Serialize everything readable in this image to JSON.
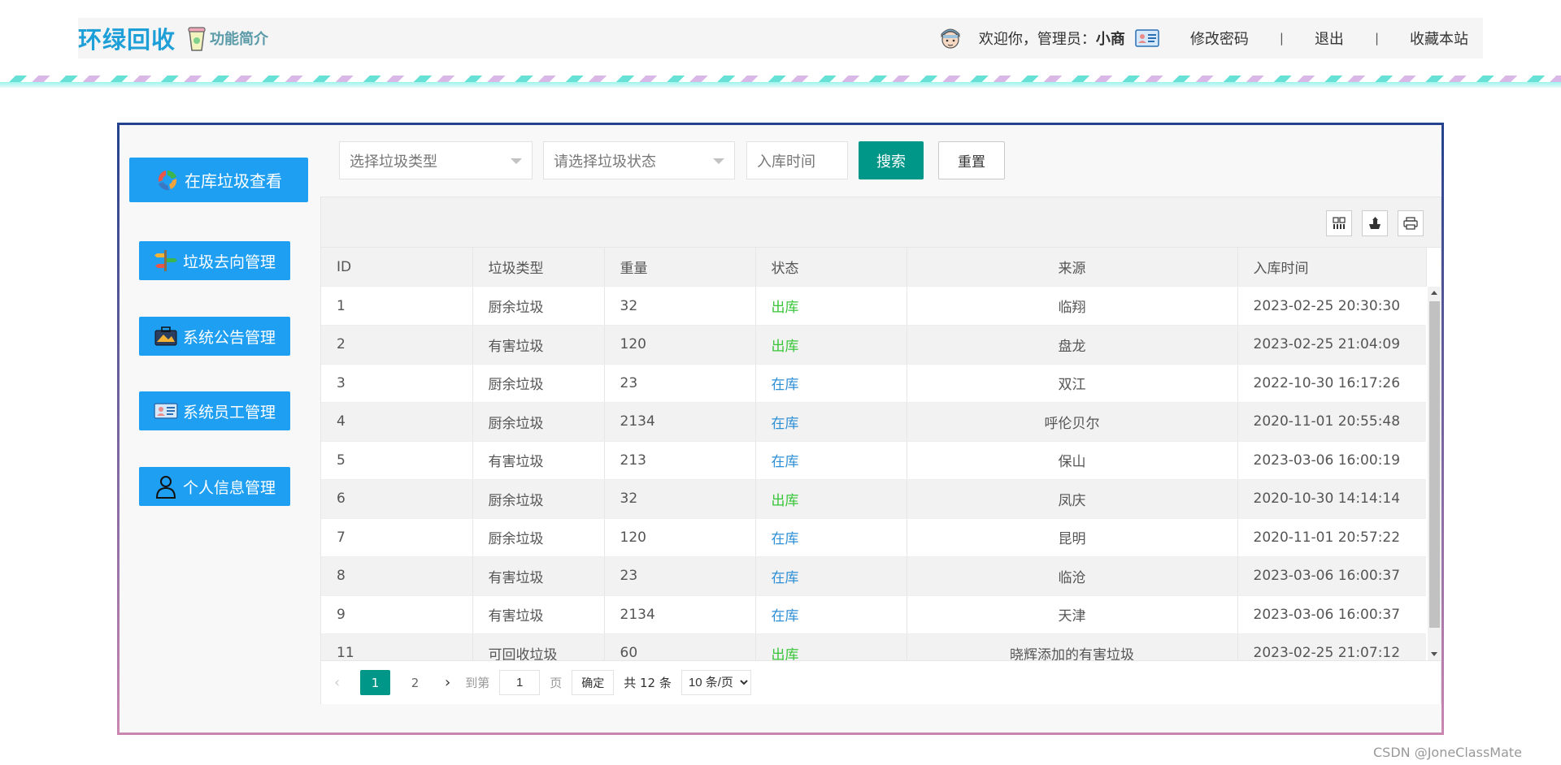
{
  "header": {
    "brand": "环绿回收",
    "intro_link": "功能简介",
    "welcome_prefix": "欢迎你，管理员：",
    "user_name": "小商",
    "change_password": "修改密码",
    "logout": "退出",
    "bookmark": "收藏本站",
    "separator": "|"
  },
  "sidebar": {
    "items": [
      {
        "label": "在库垃圾查看",
        "icon": "recycle-icon"
      },
      {
        "label": "垃圾去向管理",
        "icon": "signpost-icon"
      },
      {
        "label": "系统公告管理",
        "icon": "briefcase-icon"
      },
      {
        "label": "系统员工管理",
        "icon": "id-card-icon"
      },
      {
        "label": "个人信息管理",
        "icon": "person-icon"
      }
    ]
  },
  "filters": {
    "type_placeholder": "选择垃圾类型",
    "status_placeholder": "请选择垃圾状态",
    "date_placeholder": "入库时间",
    "search_label": "搜索",
    "reset_label": "重置"
  },
  "toolbar": {
    "icons": [
      "columns-icon",
      "export-icon",
      "print-icon"
    ]
  },
  "table": {
    "headers": [
      "ID",
      "垃圾类型",
      "重量",
      "状态",
      "来源",
      "入库时间"
    ],
    "rows": [
      {
        "id": "1",
        "type": "厨余垃圾",
        "weight": "32",
        "status": "出库",
        "source": "临翔",
        "time": "2023-02-25 20:30:30"
      },
      {
        "id": "2",
        "type": "有害垃圾",
        "weight": "120",
        "status": "出库",
        "source": "盘龙",
        "time": "2023-02-25 21:04:09"
      },
      {
        "id": "3",
        "type": "厨余垃圾",
        "weight": "23",
        "status": "在库",
        "source": "双江",
        "time": "2022-10-30 16:17:26"
      },
      {
        "id": "4",
        "type": "厨余垃圾",
        "weight": "2134",
        "status": "在库",
        "source": "呼伦贝尔",
        "time": "2020-11-01 20:55:48"
      },
      {
        "id": "5",
        "type": "有害垃圾",
        "weight": "213",
        "status": "在库",
        "source": "保山",
        "time": "2023-03-06 16:00:19"
      },
      {
        "id": "6",
        "type": "厨余垃圾",
        "weight": "32",
        "status": "出库",
        "source": "凤庆",
        "time": "2020-10-30 14:14:14"
      },
      {
        "id": "7",
        "type": "厨余垃圾",
        "weight": "120",
        "status": "在库",
        "source": "昆明",
        "time": "2020-11-01 20:57:22"
      },
      {
        "id": "8",
        "type": "有害垃圾",
        "weight": "23",
        "status": "在库",
        "source": "临沧",
        "time": "2023-03-06 16:00:37"
      },
      {
        "id": "9",
        "type": "有害垃圾",
        "weight": "2134",
        "status": "在库",
        "source": "天津",
        "time": "2023-03-06 16:00:37"
      },
      {
        "id": "11",
        "type": "可回收垃圾",
        "weight": "60",
        "status": "出库",
        "source": "晓辉添加的有害垃圾",
        "time": "2023-02-25 21:07:12"
      }
    ],
    "status_colors": {
      "出库": "#37c537",
      "在库": "#2d8fd6"
    }
  },
  "pager": {
    "pages": [
      "1",
      "2"
    ],
    "current": "1",
    "goto_prefix": "到第",
    "goto_value": "1",
    "goto_suffix": "页",
    "confirm": "确定",
    "total": "共 12 条",
    "page_size": "10 条/页"
  },
  "watermark": "CSDN @JoneClassMate",
  "colors": {
    "primary": "#1f9ff2",
    "teal": "#009688",
    "brand": "#1e9fd8"
  }
}
